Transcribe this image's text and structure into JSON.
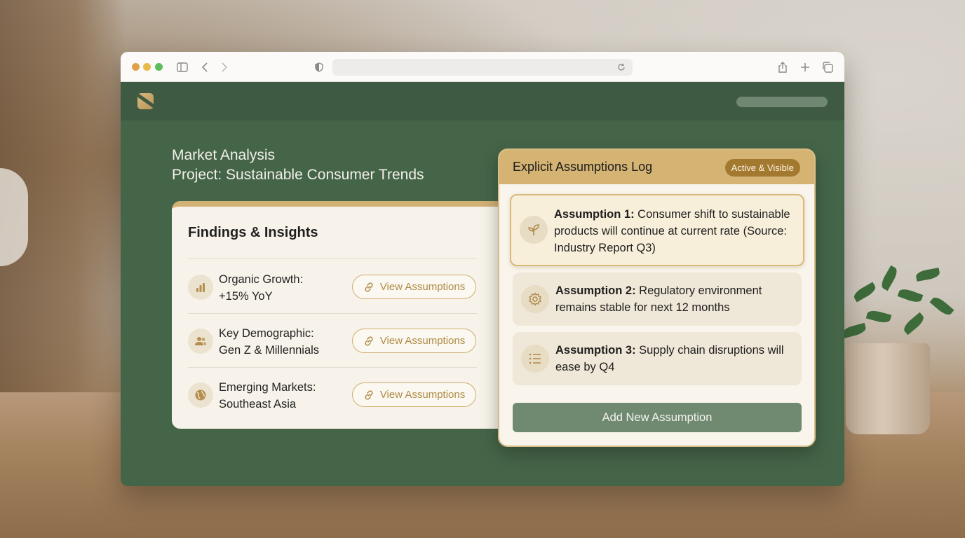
{
  "page": {
    "title_line1": "Market Analysis",
    "title_line2": "Project: Sustainable Consumer Trends"
  },
  "findings": {
    "title": "Findings & Insights",
    "items": [
      {
        "icon": "bar-chart-icon",
        "line1": "Organic Growth:",
        "line2": "+15% YoY",
        "button": "View Assumptions"
      },
      {
        "icon": "people-icon",
        "line1": "Key Demographic:",
        "line2": "Gen Z & Millennials",
        "button": "View Assumptions"
      },
      {
        "icon": "globe-icon",
        "line1": "Emerging Markets:",
        "line2": "Southeast Asia",
        "button": "View Assumptions"
      }
    ]
  },
  "assumptions": {
    "title": "Explicit Assumptions Log",
    "badge": "Active & Visible",
    "items": [
      {
        "icon": "sprout-icon",
        "label": "Assumption 1:",
        "text": " Consumer shift to sustainable products will continue at current rate (Source: Industry Report Q3)"
      },
      {
        "icon": "gear-icon",
        "label": "Assumption 2:",
        "text": " Regulatory environment remains stable for next 12 months"
      },
      {
        "icon": "list-icon",
        "label": "Assumption 3:",
        "text": " Supply chain disruptions will ease by Q4"
      }
    ],
    "add_button": "Add New Assumption"
  },
  "colors": {
    "app_green": "#456549",
    "accent_gold": "#d4b373",
    "badge_brown": "#a3782f",
    "button_green": "#6f8a71"
  }
}
